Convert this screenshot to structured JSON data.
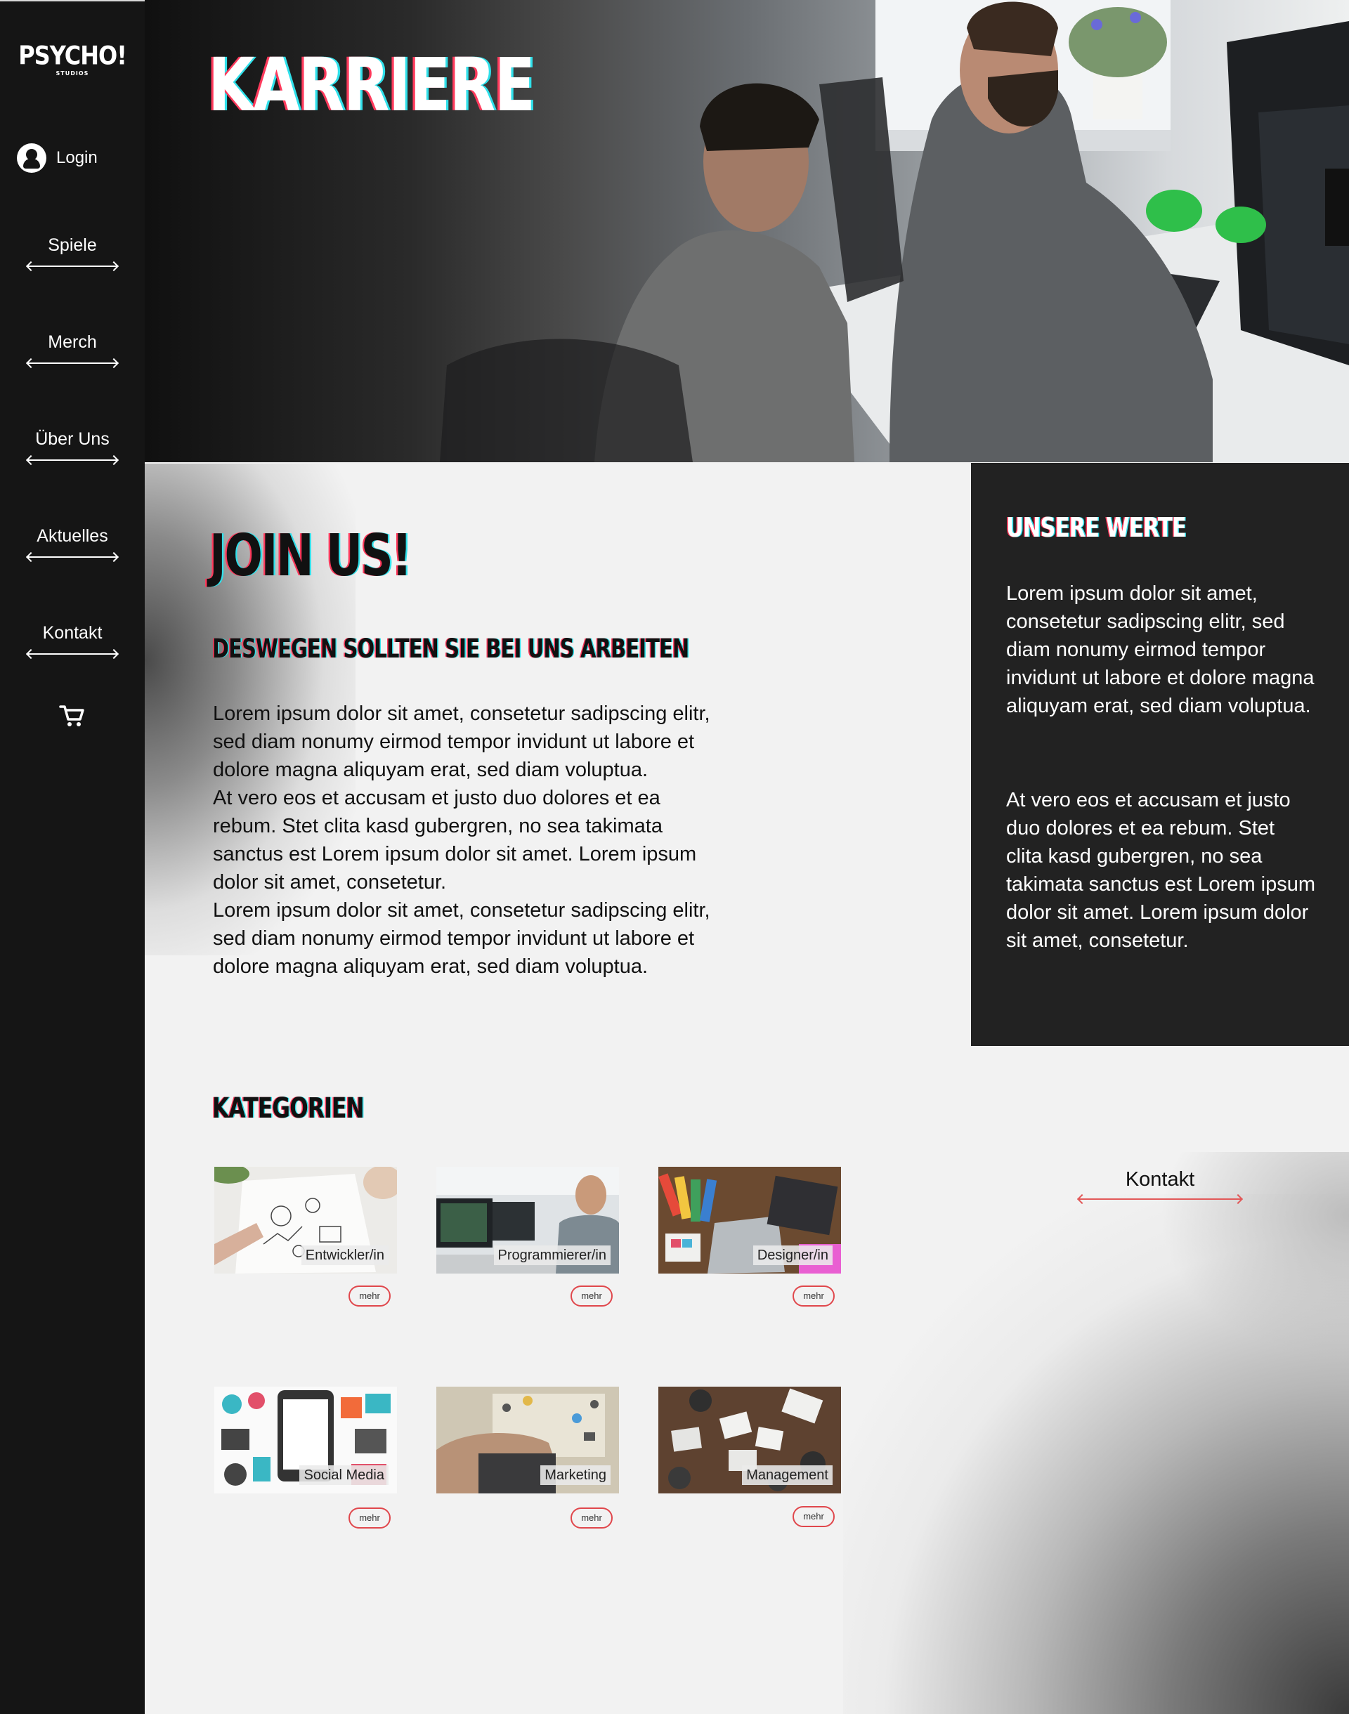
{
  "sidebar": {
    "logo_main": "PSYCHO!",
    "logo_sub": "STUDIOS",
    "login_label": "Login",
    "nav": [
      "Spiele",
      "Merch",
      "Über Uns",
      "Aktuelles",
      "Kontakt"
    ]
  },
  "hero": {
    "title": "KARRIERE"
  },
  "main": {
    "heading": "JOIN US!",
    "subheading": "DESWEGEN SOLLTEN SIE BEI UNS ARBEITEN",
    "body": "Lorem ipsum dolor sit amet, consetetur sadipscing elitr, sed diam nonumy eirmod tempor invidunt ut labore et dolore magna aliquyam erat, sed diam voluptua.\nAt vero eos et accusam et justo duo dolores et ea rebum. Stet clita kasd gubergren, no sea takimata sanctus est Lorem ipsum dolor sit amet. Lorem ipsum dolor sit amet, consetetur.\nLorem ipsum dolor sit amet, consetetur sadipscing elitr, sed diam nonumy eirmod tempor invidunt ut labore et dolore magna aliquyam erat, sed diam voluptua.",
    "categories_heading": "KATEGORIEN",
    "more_label": "mehr"
  },
  "werte": {
    "title": "UNSERE WERTE",
    "p1": "Lorem ipsum dolor sit amet, consetetur sadipscing elitr, sed diam nonumy eirmod tempor invidunt ut labore et dolore magna aliquyam erat, sed diam voluptua.",
    "p2": "At vero eos et accusam et justo duo dolores et ea rebum. Stet clita kasd gubergren, no sea takimata sanctus est Lorem ipsum dolor sit amet. Lorem ipsum dolor sit amet, consetetur."
  },
  "contact_link": "Kontakt",
  "categories": [
    "Entwickler/in",
    "Programmierer/in",
    "Designer/in",
    "Social Media",
    "Marketing",
    "Management"
  ],
  "colors": {
    "sidebar_bg": "#151515",
    "panel_bg": "#222222",
    "accent_red": "#e0474c",
    "glitch_red": "#ff3a5c",
    "glitch_cyan": "#2fe0ea"
  }
}
